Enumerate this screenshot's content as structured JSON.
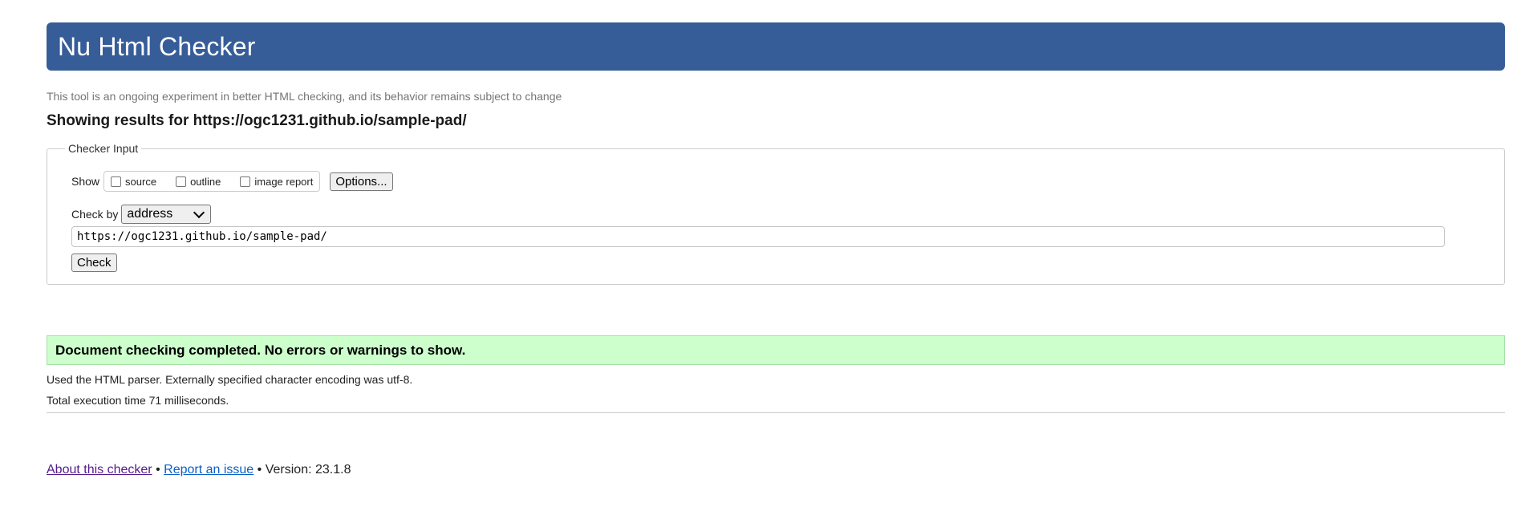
{
  "banner": {
    "title": "Nu Html Checker"
  },
  "tagline": "This tool is an ongoing experiment in better HTML checking, and its behavior remains subject to change",
  "results_heading": "Showing results for https://ogc1231.github.io/sample-pad/",
  "checker_input": {
    "legend": "Checker Input",
    "show_label": "Show",
    "options": [
      {
        "label": "source",
        "checked": false
      },
      {
        "label": "outline",
        "checked": false
      },
      {
        "label": "image report",
        "checked": false
      }
    ],
    "options_button": "Options...",
    "check_by_label": "Check by",
    "check_by_value": "address",
    "url_value": "https://ogc1231.github.io/sample-pad/",
    "check_button": "Check"
  },
  "result": {
    "message": "Document checking completed. No errors or warnings to show.",
    "parser_info": "Used the HTML parser. Externally specified character encoding was utf-8.",
    "execution_time": "Total execution time 71 milliseconds."
  },
  "footer": {
    "about_link": "About this checker",
    "separator": "•",
    "report_link": "Report an issue",
    "version": "Version: 23.1.8"
  },
  "colors": {
    "banner_bg": "#365d98",
    "success_bg": "#ccffcc",
    "visited_link": "#551a8b",
    "link": "#0b5fc6"
  }
}
